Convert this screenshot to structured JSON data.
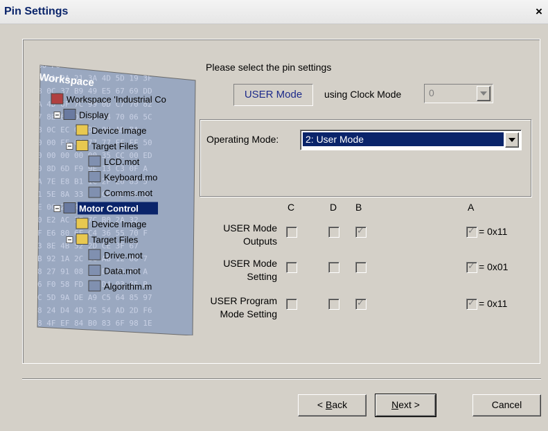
{
  "window": {
    "title": "Pin Settings",
    "close_glyph": "×"
  },
  "illustration": {
    "hex_rows": [
      "80 F0 4B D3 8D 9B C7 59",
      "7 2A 9A 21 3A 4D 5D 19 3F",
      "B 0C 37 B9 49 E5 67 69 DD",
      "A 4D 6F 7C 99 0D C7 70 82",
      "7 8B 6E D6 83 74 70 06 5C",
      "B 0C EC 00 D0 00 AD BA",
      "0 00 FF 00 77 77 FF FF 50",
      "0 00 00 00 00 35 CC 00 ED",
      "0 8D 6D F9 9E 13 C3 0F A",
      "A 7E E8 B1 1C 2F E6 83 5",
      "1 5E 8A 33 1B C6 A3 4C 1",
      "E 0C 22 4A 33 BE BF 6B",
      "0 E2 AC 3F 7C B0 2A 32",
      "F E6 80 6F C4 36 55 70 F",
      "3 8E 4B 52 2D CE 3F 67",
      "B 92 1A 2C 0C AB 12 00 7",
      "8 27 91 08 16 D3 35 F5 A",
      "6 F0 58 FD 51 D4 03 85 B",
      "C 5D 9A DE A9 C5 64 85 97",
      "8 24 D4 4D 75 54 AD 2D F6",
      "8 4F EF 84 B0 83 6F 98 1E"
    ],
    "workspace_title": "Workspace",
    "tree": [
      {
        "label": "Workspace 'Industrial Co",
        "level": 0,
        "icon": "workspace",
        "expander": ""
      },
      {
        "label": "Display",
        "level": 1,
        "icon": "project",
        "expander": "-"
      },
      {
        "label": "Device Image",
        "level": 2,
        "icon": "folder",
        "expander": ""
      },
      {
        "label": "Target Files",
        "level": 2,
        "icon": "folder-open",
        "expander": "-"
      },
      {
        "label": "LCD.mot",
        "level": 3,
        "icon": "file",
        "expander": ""
      },
      {
        "label": "Keyboard.mo",
        "level": 3,
        "icon": "file",
        "expander": ""
      },
      {
        "label": "Comms.mot",
        "level": 3,
        "icon": "file",
        "expander": ""
      },
      {
        "label": "Motor Control",
        "level": 1,
        "icon": "project",
        "expander": "-",
        "selected": true
      },
      {
        "label": "Device Image",
        "level": 2,
        "icon": "folder",
        "expander": ""
      },
      {
        "label": "Target Files",
        "level": 2,
        "icon": "folder-open",
        "expander": "-"
      },
      {
        "label": "Drive.mot",
        "level": 3,
        "icon": "file",
        "expander": ""
      },
      {
        "label": "Data.mot",
        "level": 3,
        "icon": "file",
        "expander": ""
      },
      {
        "label": "Algorithm.m",
        "level": 3,
        "icon": "file",
        "expander": ""
      }
    ]
  },
  "prompt": "Please select the pin settings",
  "mode_label": "USER Mode",
  "using_clock_label": "using Clock Mode",
  "clock_mode": {
    "value": "0",
    "disabled": true
  },
  "operating_mode": {
    "label": "Operating Mode:",
    "selected": "2: User Mode"
  },
  "pins": {
    "columns": [
      "C",
      "D",
      "B",
      "A"
    ],
    "rows": [
      {
        "label_line1": "USER Mode",
        "label_line2": "Outputs",
        "C": false,
        "D": false,
        "B": true,
        "A": true,
        "value": "= 0x11"
      },
      {
        "label_line1": "USER Mode",
        "label_line2": "Setting",
        "C": false,
        "D": false,
        "B": false,
        "A": true,
        "value": "= 0x01"
      },
      {
        "label_line1": "USER Program",
        "label_line2": "Mode Setting",
        "C": false,
        "D": false,
        "B": true,
        "A": true,
        "value": "= 0x11"
      }
    ]
  },
  "buttons": {
    "back": {
      "prefix": "< ",
      "mnemonic": "B",
      "rest": "ack"
    },
    "next": {
      "mnemonic": "N",
      "rest": "ext >"
    },
    "cancel": "Cancel"
  },
  "colors": {
    "title_text": "#0a246a",
    "selection": "#0a246a",
    "mode_text": "#1c2a8a",
    "dialog_bg": "#d4d0c8"
  }
}
